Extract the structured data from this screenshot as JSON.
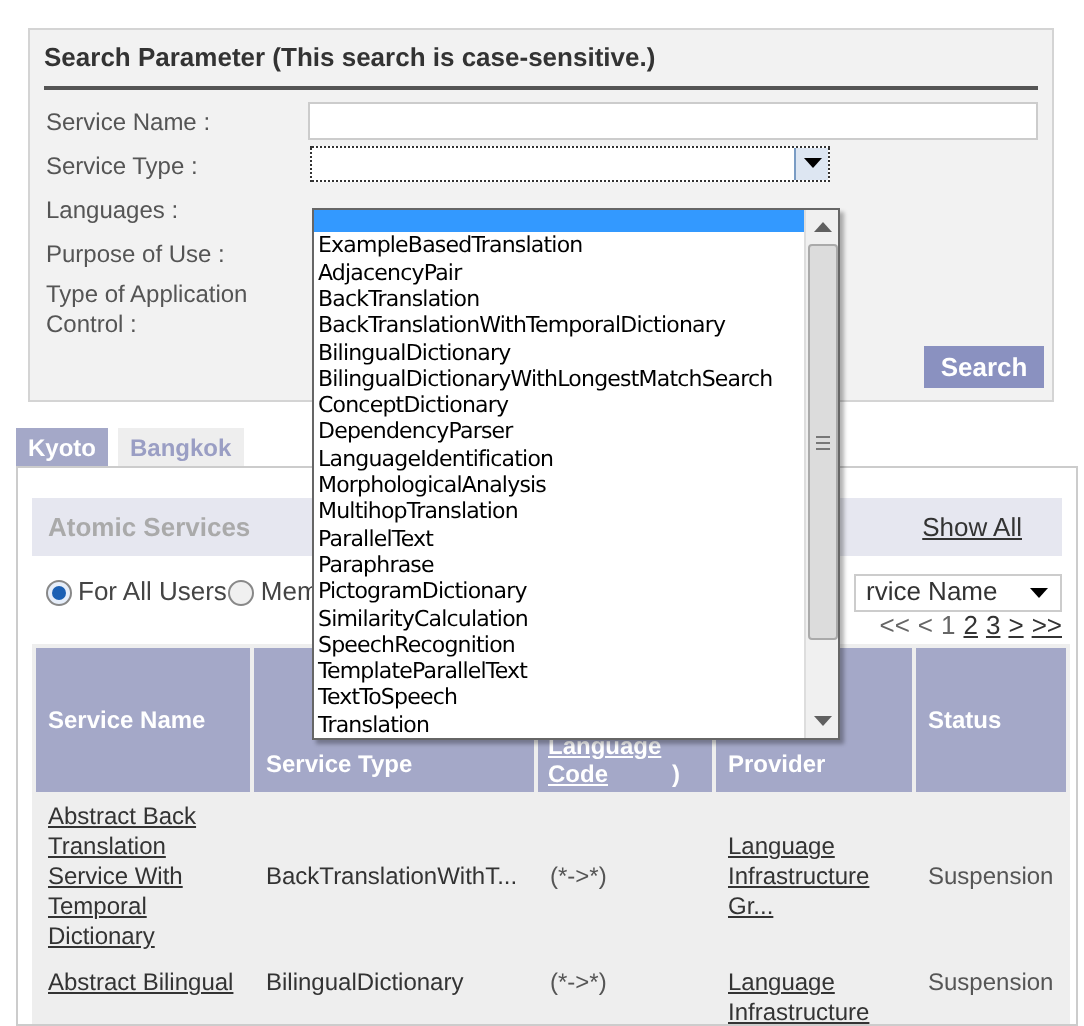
{
  "search_panel": {
    "title": "Search Parameter (This search is case-sensitive.)",
    "fields": [
      {
        "label": "Service Name :",
        "kind": "text"
      },
      {
        "label": "Service Type :",
        "kind": "select"
      },
      {
        "label": "Languages :",
        "kind": "none"
      },
      {
        "label": "Purpose of Use :",
        "kind": "none"
      },
      {
        "label": "Type of Application Control :",
        "kind": "none"
      }
    ],
    "button": "Search"
  },
  "dropdown": {
    "blank_row_selected": true,
    "options": [
      {
        "label": "ExampleBasedTranslation",
        "selected": false
      },
      {
        "label": "AdjacencyPair",
        "selected": false
      },
      {
        "label": "BackTranslation",
        "selected": false
      },
      {
        "label": "BackTranslationWithTemporalDictionary",
        "selected": false
      },
      {
        "label": "BilingualDictionary",
        "selected": false
      },
      {
        "label": "BilingualDictionaryWithLongestMatchSearch",
        "selected": false
      },
      {
        "label": "ConceptDictionary",
        "selected": false
      },
      {
        "label": "DependencyParser",
        "selected": false
      },
      {
        "label": "LanguageIdentification",
        "selected": false
      },
      {
        "label": "MorphologicalAnalysis",
        "selected": false
      },
      {
        "label": "MultihopTranslation",
        "selected": false
      },
      {
        "label": "ParallelText",
        "selected": false
      },
      {
        "label": "Paraphrase",
        "selected": false
      },
      {
        "label": "PictogramDictionary",
        "selected": false
      },
      {
        "label": "SimilarityCalculation",
        "selected": false
      },
      {
        "label": "SpeechRecognition",
        "selected": false
      },
      {
        "label": "TemplateParallelText",
        "selected": false
      },
      {
        "label": "TextToSpeech",
        "selected": false
      },
      {
        "label": "Translation",
        "selected": false
      }
    ]
  },
  "tabs": [
    {
      "label": "Kyoto",
      "selected": true
    },
    {
      "label": "Bangkok",
      "selected": false
    }
  ],
  "section": {
    "title": "Atomic Services",
    "show_all": "Show All"
  },
  "radios": [
    {
      "label": "For All Users",
      "selected": true
    },
    {
      "label": "Mem",
      "selected": false
    }
  ],
  "sort_select": {
    "value": "rvice Name"
  },
  "pagination": [
    {
      "label": "<<",
      "link": false
    },
    {
      "label": "<",
      "link": false
    },
    {
      "label": "1",
      "link": false
    },
    {
      "label": "2",
      "link": true
    },
    {
      "label": "3",
      "link": true
    },
    {
      "label": ">",
      "link": true
    },
    {
      "label": ">>",
      "link": true
    }
  ],
  "table": {
    "columns": [
      {
        "label": "Service Name"
      },
      {
        "label": "Service Type"
      },
      {
        "link": "Language Code",
        "suffix": ")"
      },
      {
        "label": "Provider"
      },
      {
        "label": "Status"
      }
    ],
    "rows": [
      {
        "name": "Abstract Back Translation Service With Temporal Dictionary",
        "type": "BackTranslationWithT...",
        "languages": "(*->*)",
        "provider": "Language Infrastructure Gr...",
        "status": "Suspension"
      },
      {
        "name": "Abstract Bilingual",
        "type": "BilingualDictionary",
        "languages": "(*->*)",
        "provider": "Language Infrastructure",
        "status": "Suspension"
      }
    ]
  }
}
